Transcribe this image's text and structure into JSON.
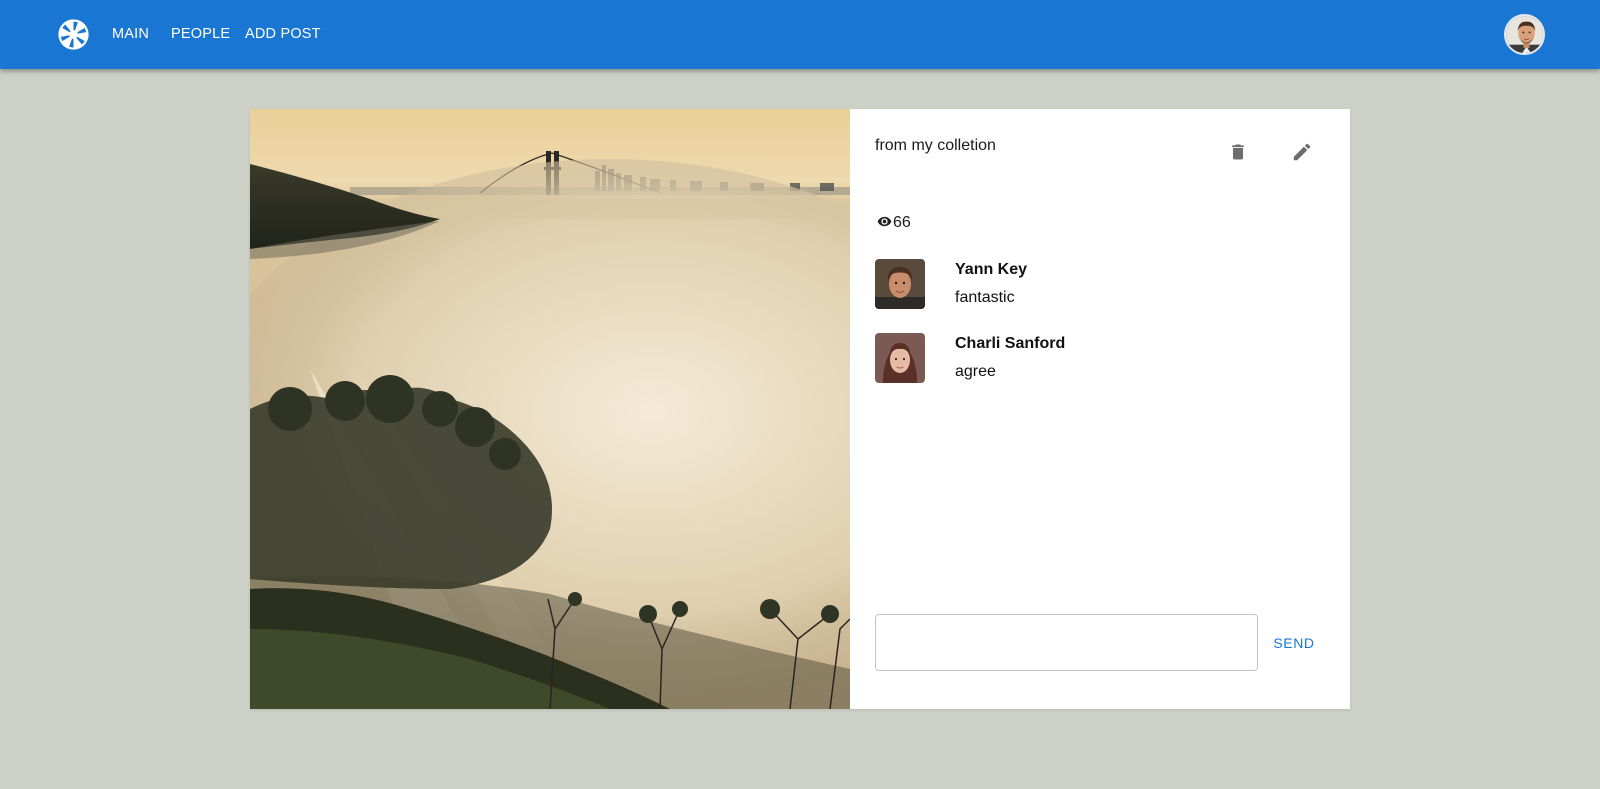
{
  "header": {
    "logo_icon": "camera-shutter-icon",
    "nav": [
      {
        "label": "MAIN"
      },
      {
        "label": "PEOPLE"
      },
      {
        "label": "ADD POST"
      }
    ],
    "user_avatar": "user-avatar-photo"
  },
  "post": {
    "caption": "from my colletion",
    "views": "66",
    "actions": {
      "delete_icon": "trash-icon",
      "edit_icon": "pencil-icon"
    },
    "comments": [
      {
        "author": "Yann Key",
        "text": "fantastic"
      },
      {
        "author": "Charli Sanford",
        "text": "agree"
      }
    ],
    "comment_input": {
      "value": "",
      "placeholder": ""
    },
    "send_label": "SEND"
  },
  "colors": {
    "appbar": "#1976d2",
    "background": "#cdd0c6",
    "accent": "#1976d2"
  }
}
